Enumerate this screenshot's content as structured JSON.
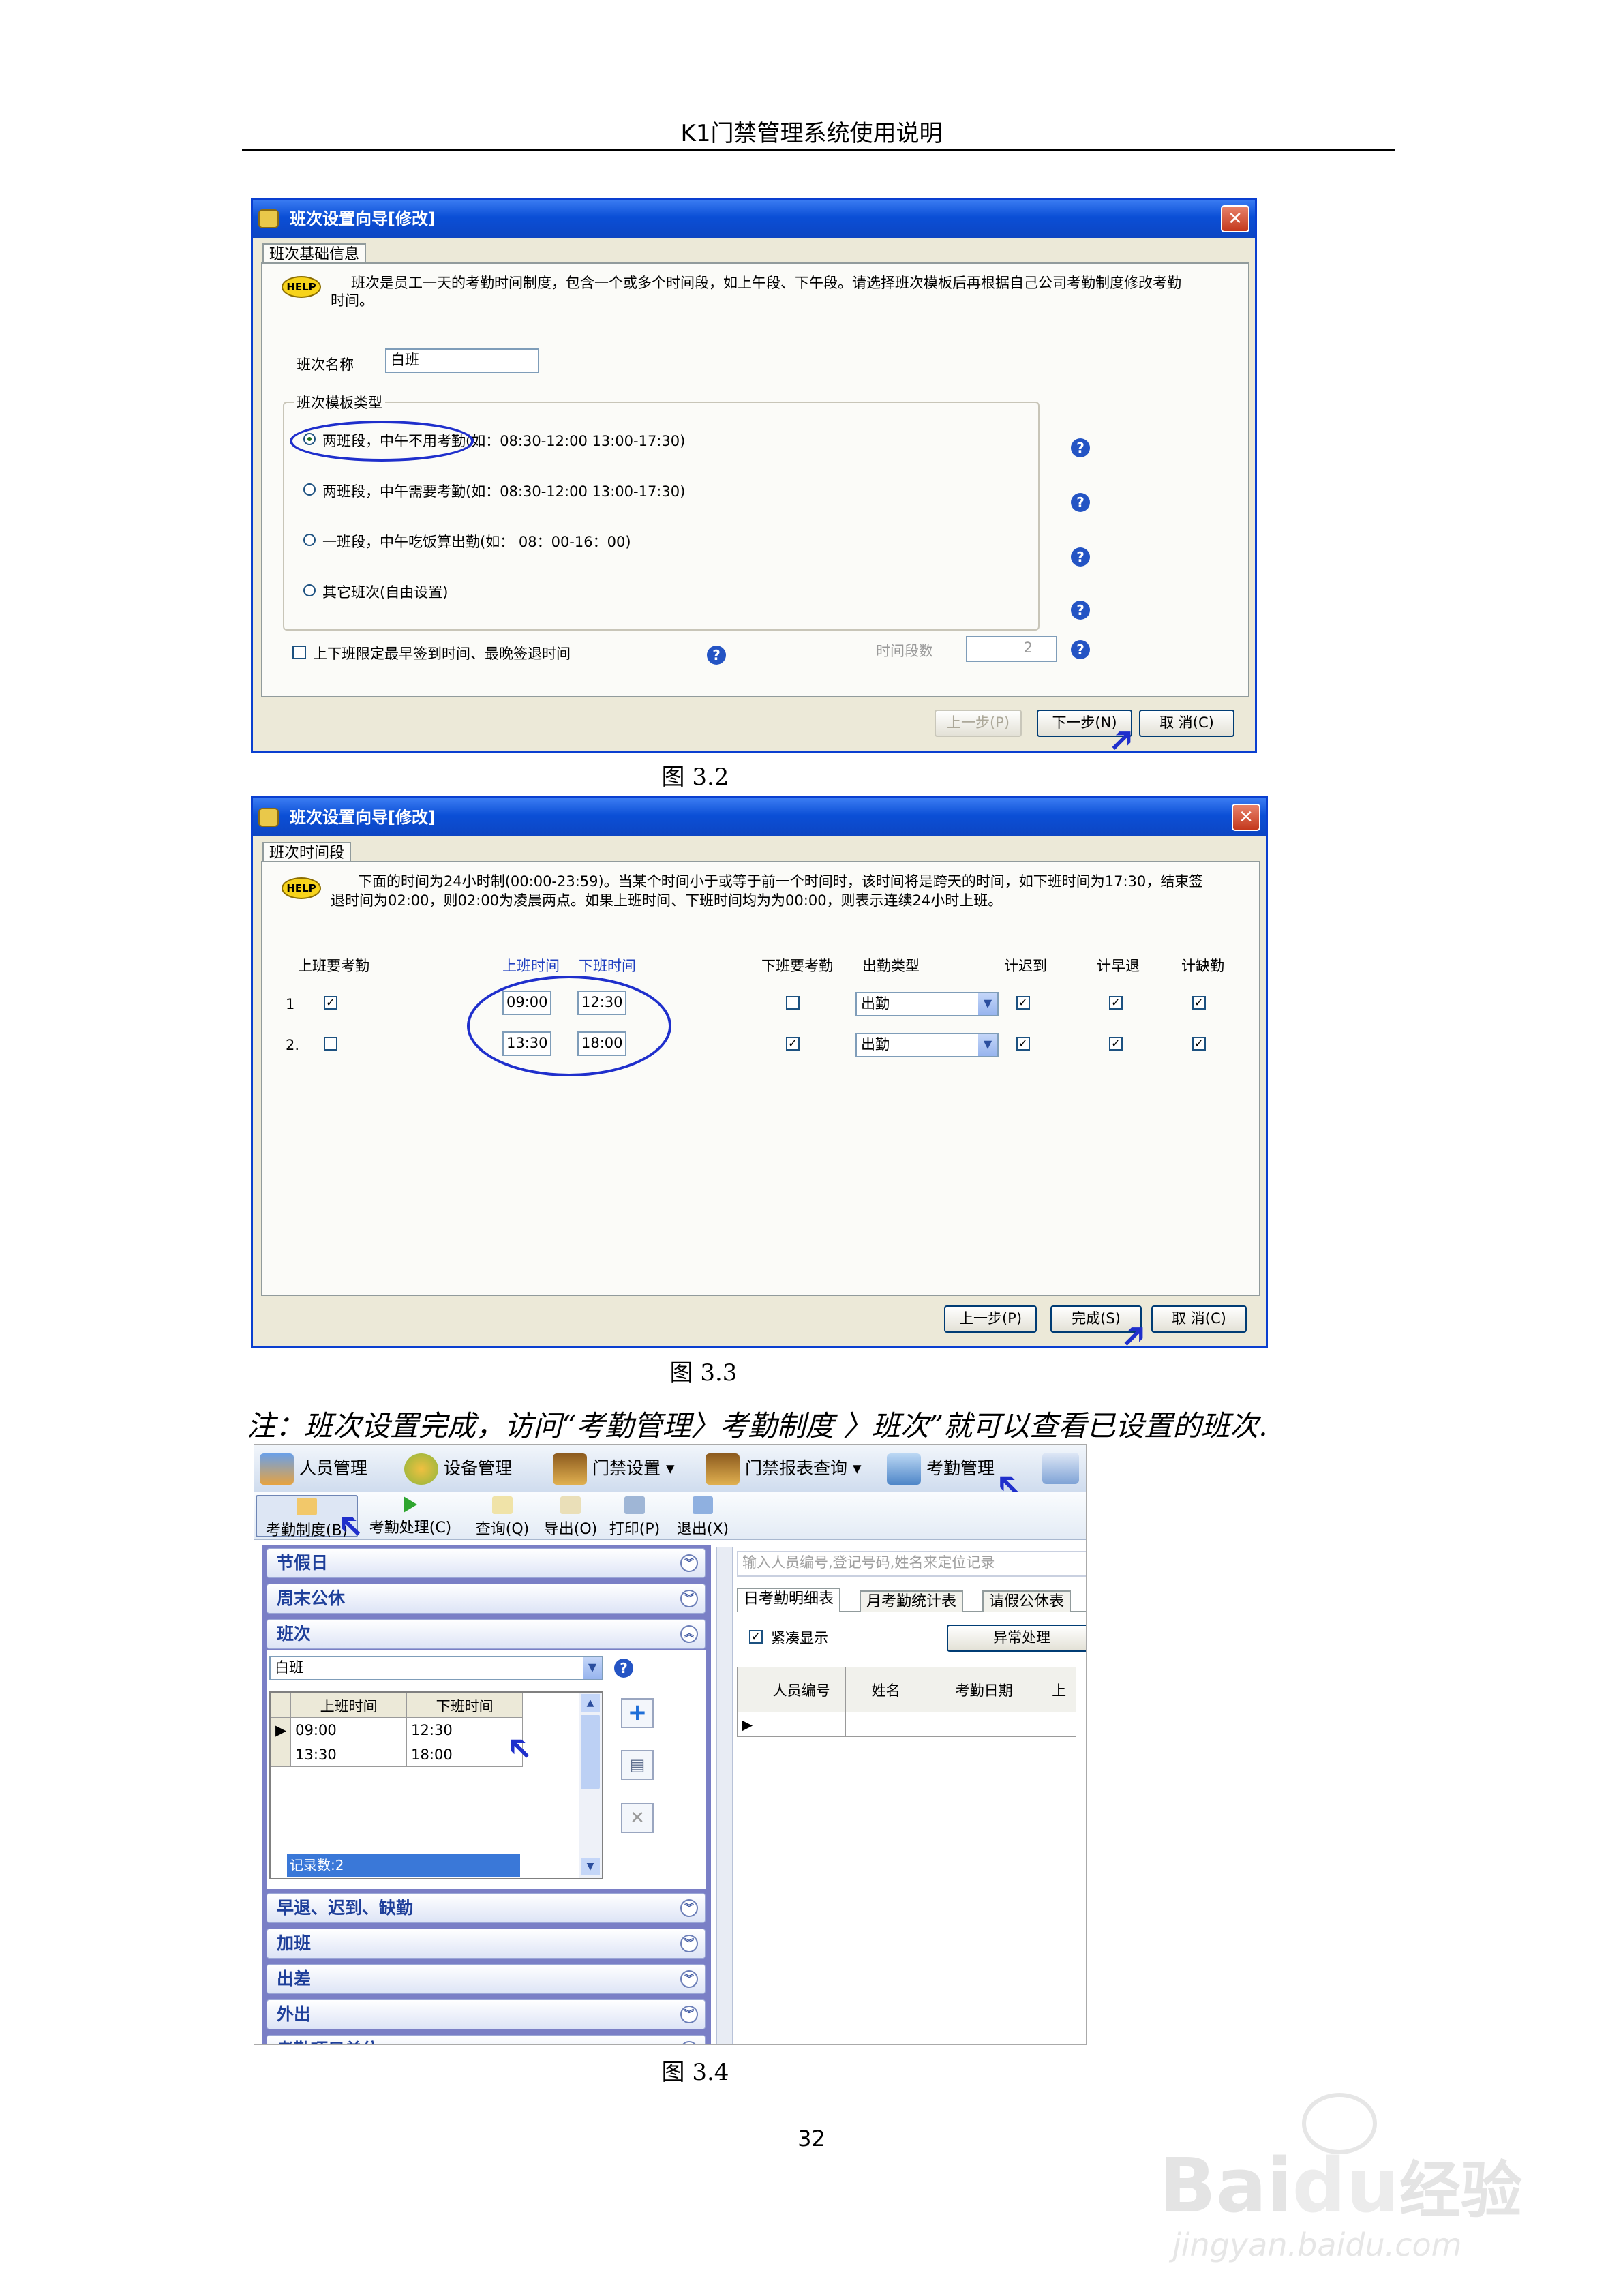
{
  "header": {
    "title": "K1门禁管理系统使用说明"
  },
  "fig32": {
    "caption": "图 3.2",
    "window_title": "班次设置向导[修改]",
    "close_label": "✕",
    "tab_label": "班次基础信息",
    "help_badge": "HELP",
    "help_text_line1": "班次是员工一天的考勤时间制度，包含一个或多个时间段，如上午段、下午段。请选择班次模板后再根据自己公司考勤制度修改考勤",
    "help_text_line2": "时间。",
    "name_label": "班次名称",
    "name_value": "白班",
    "template_group_label": "班次模板类型",
    "options": [
      "两班段，中午不用考勤(如：08:30-12:00 13:00-17:30)",
      "两班段，中午需要考勤(如：08:30-12:00 13:00-17:30)",
      "一班段，中午吃饭算出勤(如： 08：00-16：00)",
      "其它班次(自由设置)"
    ],
    "selected_option": 0,
    "limit_checkbox_label": "上下班限定最早签到时间、最晚签退时间",
    "segment_count_label": "时间段数",
    "segment_count_value": "2",
    "prev_button": "上一步(P)",
    "next_button": "下一步(N)",
    "cancel_button": "取 消(C)"
  },
  "fig33": {
    "caption": "图 3.3",
    "window_title": "班次设置向导[修改]",
    "close_label": "✕",
    "tab_label": "班次时间段",
    "help_badge": "HELP",
    "help_text_line1": "下面的时间为24小时制(00:00-23:59)。当某个时间小于或等于前一个时间时，该时间将是跨天的时间，如下班时间为17:30，结束签",
    "help_text_line2": "退时间为02:00，则02:00为凌晨两点。如果上班时间、下班时间均为为00:00，则表示连续24小时上班。",
    "columns": {
      "need_on": "上班要考勤",
      "on_time": "上班时间",
      "off_time": "下班时间",
      "need_off": "下班要考勤",
      "type": "出勤类型",
      "late": "计迟到",
      "early": "计早退",
      "absent": "计缺勤"
    },
    "rows": [
      {
        "no": "1",
        "need_on": true,
        "on": "09:00",
        "off": "12:30",
        "need_off": false,
        "type": "出勤",
        "late": true,
        "early": true,
        "absent": true
      },
      {
        "no": "2.",
        "need_on": false,
        "on": "13:30",
        "off": "18:00",
        "need_off": true,
        "type": "出勤",
        "late": true,
        "early": true,
        "absent": true
      }
    ],
    "prev_button": "上一步(P)",
    "finish_button": "完成(S)",
    "cancel_button": "取 消(C)"
  },
  "note": "注：班次设置完成，访问“考勤管理〉考勤制度 〉班次”就可以查看已设置的班次.",
  "fig34": {
    "caption": "图 3.4",
    "main_menu": [
      "人员管理",
      "设备管理",
      "门禁设置",
      "门禁报表查询",
      "考勤管理"
    ],
    "sub_toolbar": [
      "考勤制度(B)",
      "考勤处理(C)",
      "查询(Q)",
      "导出(O)",
      "打印(P)",
      "退出(X)"
    ],
    "sections_top": [
      "节假日",
      "周末公休",
      "班次"
    ],
    "shift_select": "白班",
    "grid_headers": [
      "上班时间",
      "下班时间"
    ],
    "grid_rows": [
      [
        "09:00",
        "12:30"
      ],
      [
        "13:30",
        "18:00"
      ]
    ],
    "record_count": "记录数:2",
    "sections_bottom": [
      "早退、迟到、缺勤",
      "加班",
      "出差",
      "外出",
      "考勤项目单位"
    ],
    "search_placeholder": "输入人员编号,登记号码,姓名来定位记录",
    "tabs": [
      "日考勤明细表",
      "月考勤统计表",
      "请假公休表"
    ],
    "compact_label": "紧凑显示",
    "abnormal_button": "异常处理",
    "table_headers": [
      "人员编号",
      "姓名",
      "考勤日期",
      "上"
    ]
  },
  "page_number": "32",
  "watermark": {
    "brand_a": "Bai",
    "brand_b": "du",
    "brand_c": "经验",
    "url": "jingyan.baidu.com"
  },
  "colors": {
    "xp_title": "#0b4fd6",
    "annotation_blue": "#1f2fcc",
    "section_bar": "#7a7fc6"
  }
}
